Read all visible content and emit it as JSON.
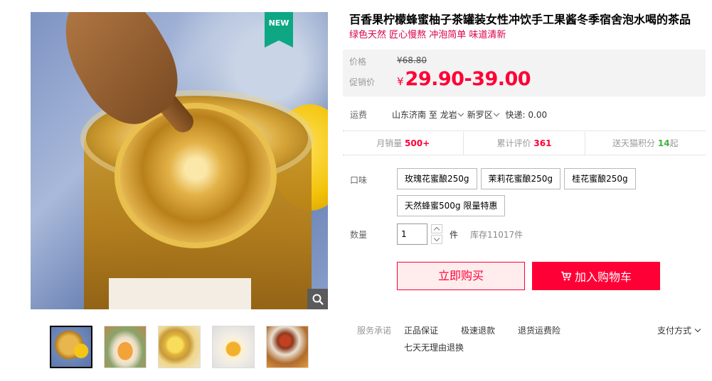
{
  "gallery": {
    "badge": "NEW",
    "zoom_icon": "magnifier-icon",
    "thumbnails": [
      "thumb-1",
      "thumb-2",
      "thumb-3",
      "thumb-4",
      "thumb-5"
    ],
    "active_index": 0
  },
  "product": {
    "title": "百香果柠檬蜂蜜柚子茶罐装女性冲饮手工果酱冬季宿舍泡水喝的茶品",
    "subtitle": "绿色天然 匠心慢熬 冲泡简单 味道清新"
  },
  "price": {
    "orig_label": "价格",
    "orig_currency": "¥",
    "orig_value": "68.80",
    "promo_label": "促销价",
    "promo_currency": "¥",
    "promo_value": "29.90-39.00",
    "accent_color": "#ff0036"
  },
  "shipping": {
    "label": "运费",
    "origin": "山东济南",
    "to": "至",
    "dest_city": "龙岩",
    "dest_district": "新罗区",
    "method": "快递: 0.00"
  },
  "stats": {
    "monthly_sales_label": "月销量",
    "monthly_sales_value": "500+",
    "reviews_label": "累计评价",
    "reviews_value": "361",
    "points_label": "送天猫积分",
    "points_value": "14",
    "points_suffix": "起"
  },
  "flavor": {
    "label": "口味",
    "options": [
      "玫瑰花蜜酿250g",
      "茉莉花蜜酿250g",
      "桂花蜜酿250g",
      "天然蜂蜜500g 限量特惠"
    ]
  },
  "quantity": {
    "label": "数量",
    "value": "1",
    "unit": "件",
    "stock": "库存11017件"
  },
  "actions": {
    "buy_now": "立即购买",
    "add_to_cart": "加入购物车"
  },
  "services": {
    "label": "服务承诺",
    "items": [
      "正品保证",
      "极速退款",
      "退货运费险",
      "七天无理由退换"
    ],
    "payment": "支付方式"
  }
}
